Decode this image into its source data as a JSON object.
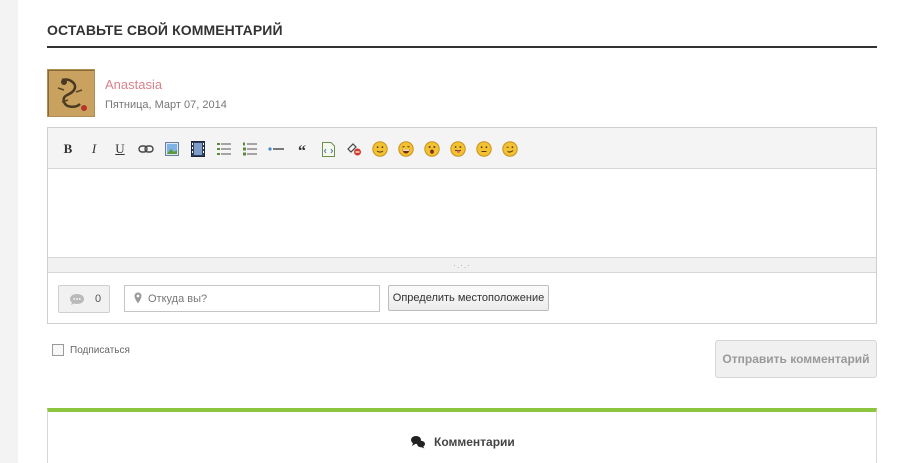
{
  "section": {
    "heading": "ОСТАВЬТЕ СВОЙ КОММЕНТАРИЙ"
  },
  "user": {
    "name": "Anastasia",
    "date": "Пятница, Март 07, 2014",
    "avatar_icon": "dragon-avatar"
  },
  "toolbar": {
    "bold_label": "B",
    "italic_label": "I",
    "underline_label": "U",
    "quote_label": "“",
    "icons": [
      "link-icon",
      "image-icon",
      "video-icon",
      "bulleted-list-icon",
      "numbered-list-icon",
      "horizontal-rule-icon",
      "quote-icon",
      "code-icon",
      "remove-format-icon",
      "smile-icon",
      "laugh-icon",
      "surprised-icon",
      "tongue-icon",
      "neutral-icon",
      "wink-icon"
    ]
  },
  "editor": {
    "value": "",
    "resize_handle": "·.·.·"
  },
  "footer": {
    "comment_count": "0",
    "location_placeholder": "Откуда вы?",
    "location_value": "",
    "detect_location_label": "Определить местоположение"
  },
  "subscribe": {
    "label": "Подписаться",
    "checked": false
  },
  "submit": {
    "label": "Отправить комментарий"
  },
  "comments": {
    "title": "Комментарии"
  },
  "colors": {
    "accent_green": "#8cc63f",
    "username_pink": "#d9828a",
    "smiley_yellow": "#f2c232"
  }
}
